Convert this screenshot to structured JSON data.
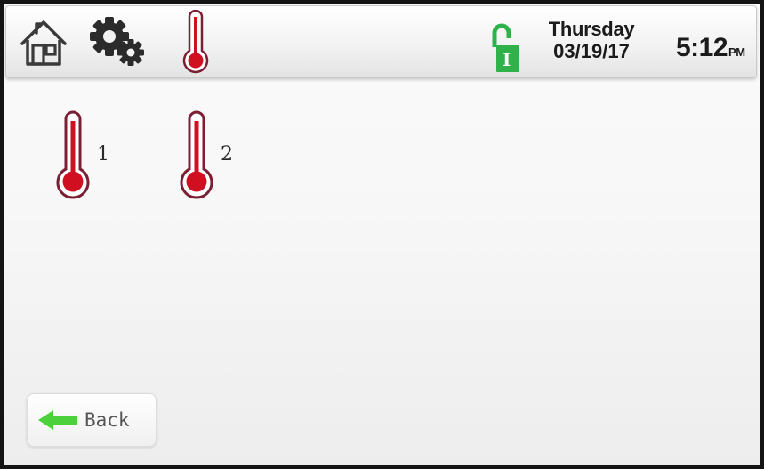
{
  "header": {
    "icons": {
      "home": "home-icon",
      "settings": "gear-icon",
      "temperature": "thermometer-icon",
      "lock": "unlocked-padlock-icon"
    },
    "lock_letter": "I",
    "day": "Thursday",
    "date": "03/19/17",
    "time": "5:12",
    "ampm": "PM"
  },
  "sensors": [
    {
      "label": "1",
      "icon": "thermometer-icon"
    },
    {
      "label": "2",
      "icon": "thermometer-icon"
    }
  ],
  "back_button": {
    "label": "Back",
    "icon": "arrow-left-icon"
  },
  "colors": {
    "accent_red": "#d01020",
    "thermo_outline": "#7a1f34",
    "lock_green": "#2fb24a",
    "arrow_green": "#4cd13d"
  }
}
